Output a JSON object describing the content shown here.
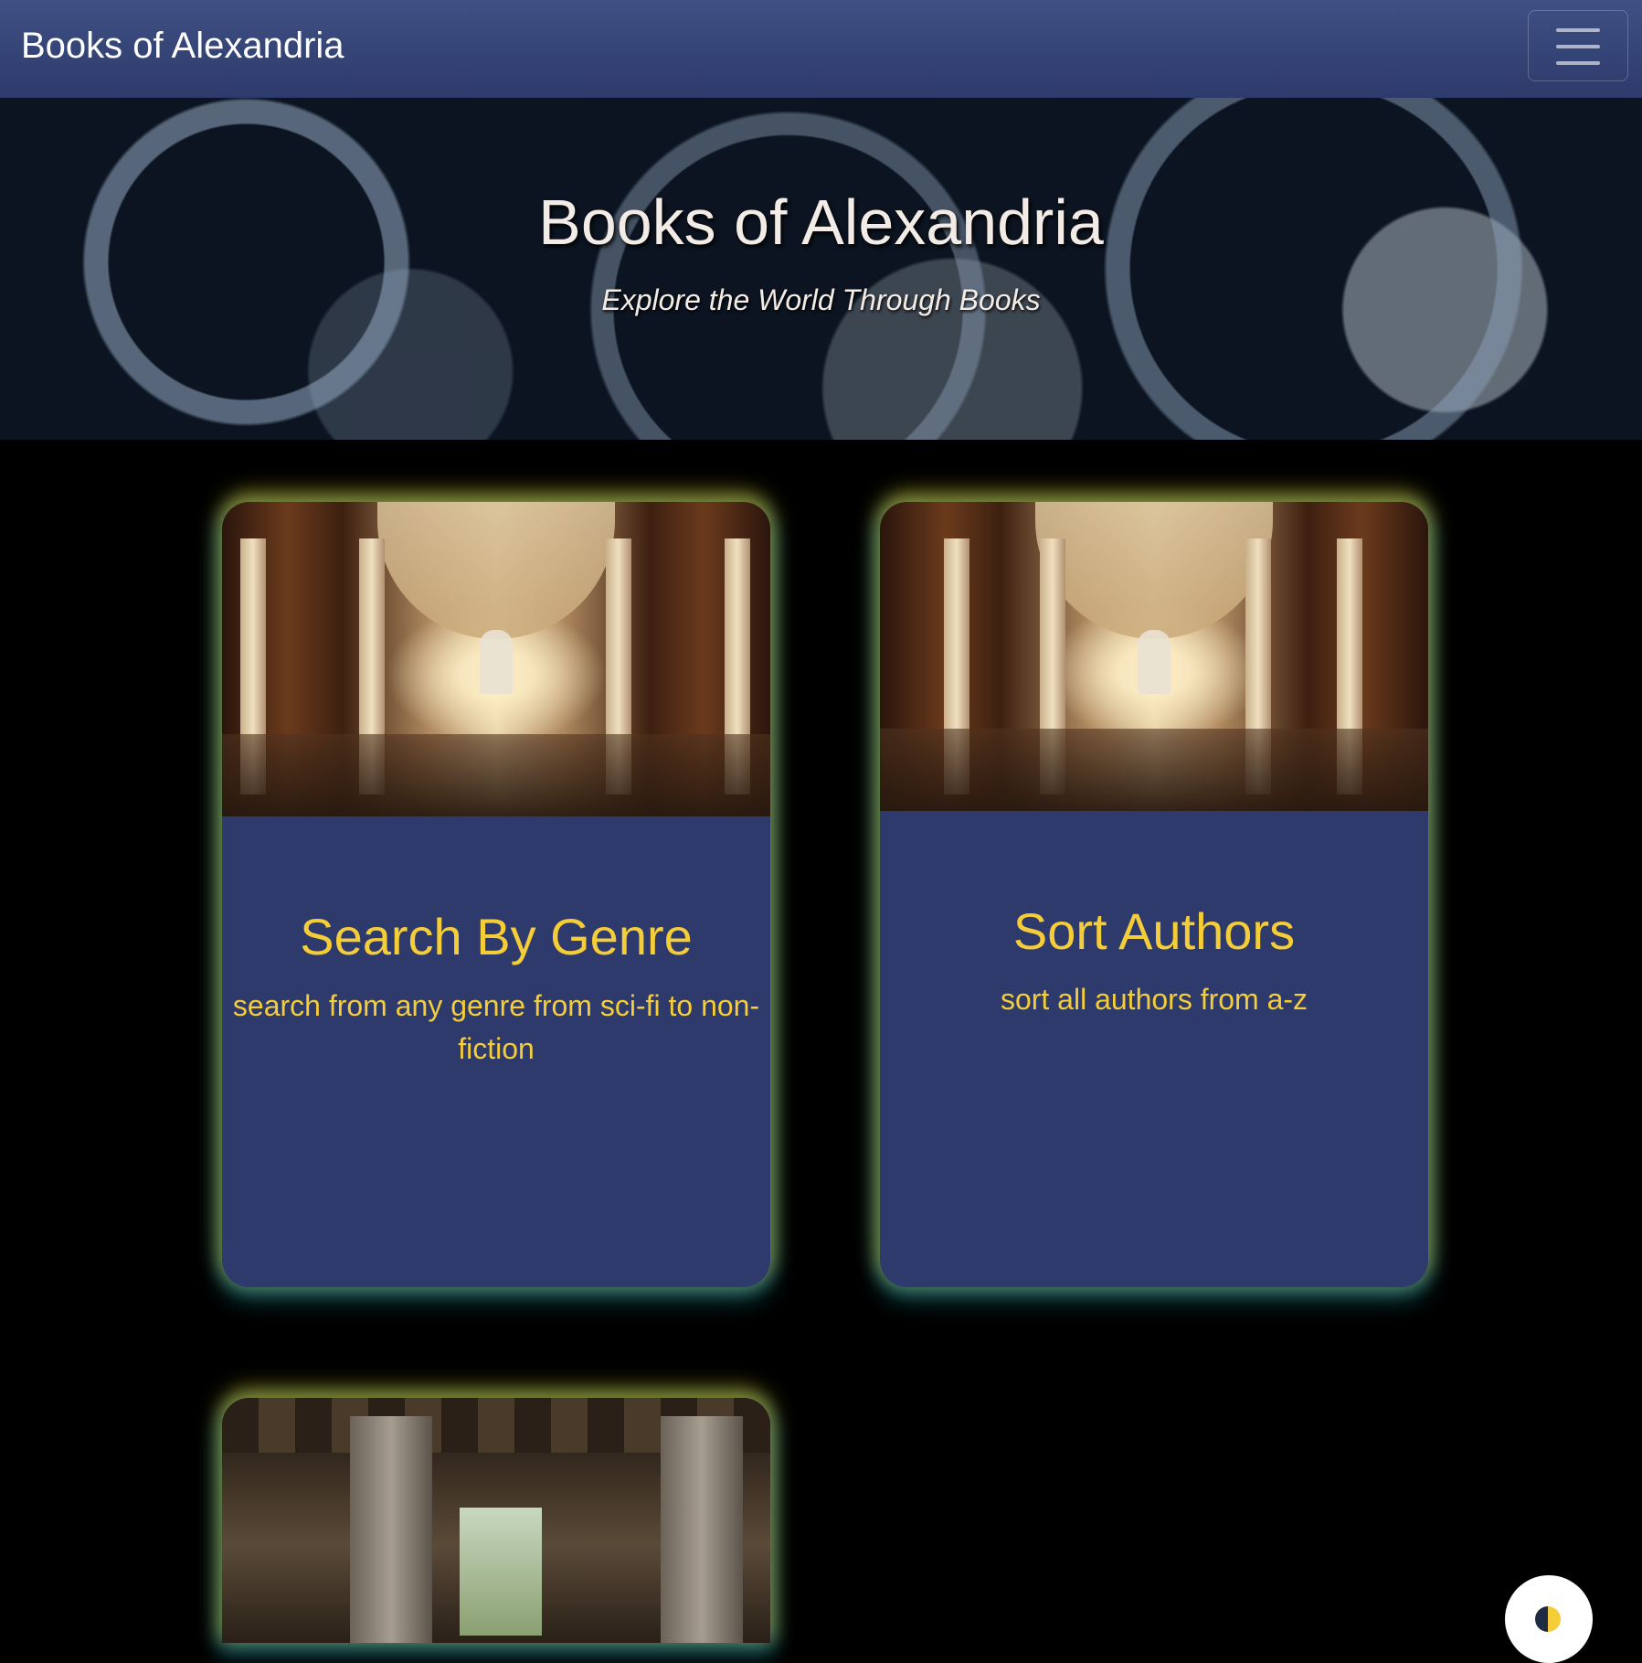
{
  "navbar": {
    "brand": "Books of Alexandria",
    "menu_icon": "hamburger-menu-icon"
  },
  "hero": {
    "title": "Books of Alexandria",
    "subtitle": "Explore the World Through Books"
  },
  "cards": [
    {
      "title": "Search By Genre",
      "text": "search from any genre from sci-fi to non-fiction",
      "image": "library-hall-image"
    },
    {
      "title": "Sort Authors",
      "text": "sort all authors from a-z",
      "image": "library-hall-image"
    },
    {
      "title": "",
      "text": "",
      "image": "library-pillars-image"
    }
  ],
  "theme_toggle": {
    "icon": "half-moon-icon"
  },
  "colors": {
    "navbar": "#2d3a6b",
    "card_background": "#2d3a6b",
    "card_text": "#f4cd38",
    "page_background": "#000000"
  }
}
